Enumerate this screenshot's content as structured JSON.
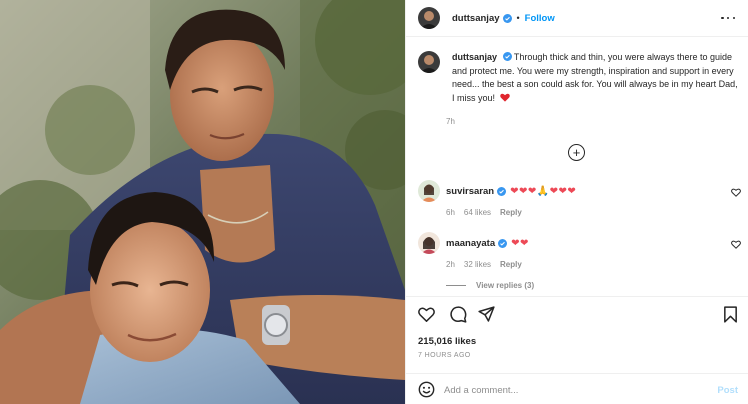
{
  "post": {
    "username": "duttsanjay",
    "follow_label": "Follow",
    "separator": "•",
    "more_icon": "more-options-icon"
  },
  "caption": {
    "username": "duttsanjay",
    "text": "Through thick and thin, you were always there to guide and protect me. You were my strength, inspiration and support in every need... the best a son could ask for. You will always be in my heart Dad, I miss you!",
    "emoji": "❤️",
    "time": "7h"
  },
  "load_more_icon": "plus-circle-icon",
  "comments": [
    {
      "username": "suvirsaran",
      "text": "❤❤❤🙏❤❤❤",
      "time": "6h",
      "likes": "64 likes",
      "reply_label": "Reply"
    },
    {
      "username": "maanayata",
      "text": "❤❤",
      "time": "2h",
      "likes": "32 likes",
      "reply_label": "Reply"
    }
  ],
  "view_replies": "View replies (3)",
  "actions": {
    "like_icon": "heart-icon",
    "comment_icon": "comment-icon",
    "share_icon": "share-icon",
    "save_icon": "bookmark-icon"
  },
  "likes_count": "215,016 likes",
  "time_ago": "7 HOURS AGO",
  "add_comment": {
    "placeholder": "Add a comment...",
    "post_label": "Post",
    "emoji_icon": "emoji-icon"
  },
  "colors": {
    "link_blue": "#0095f6",
    "heart_red": "#ed4956",
    "muted": "#8e8e8e",
    "post_disabled": "#b2dffc"
  }
}
